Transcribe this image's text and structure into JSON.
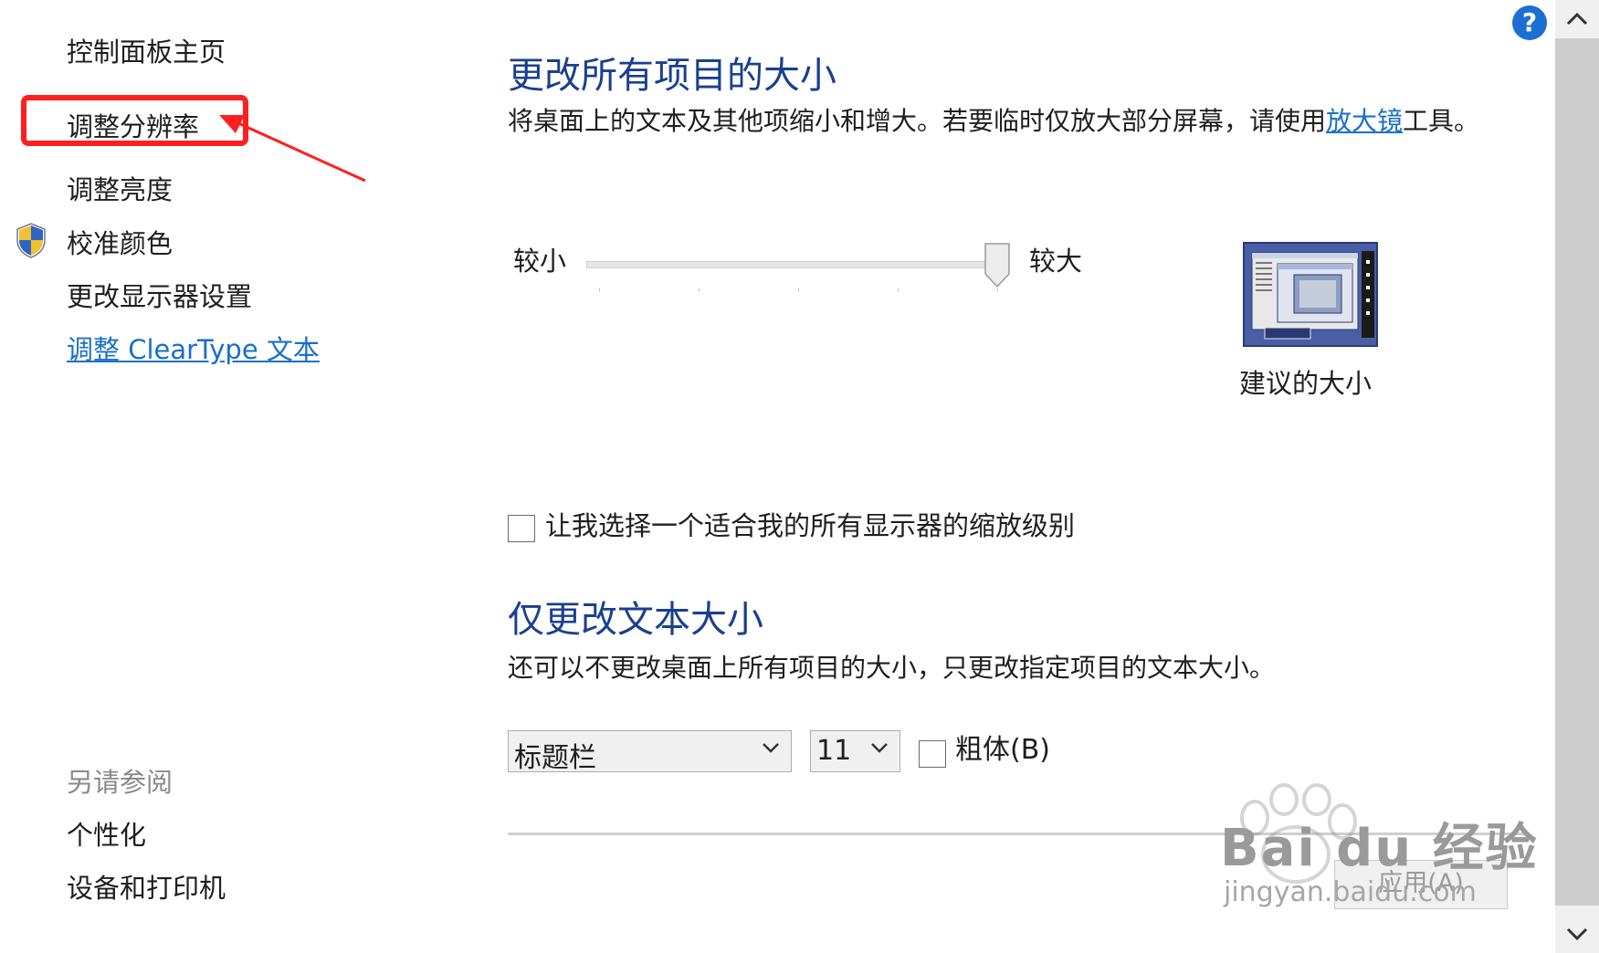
{
  "sidebar": {
    "items": [
      {
        "label": "控制面板主页"
      },
      {
        "label": "调整分辨率"
      },
      {
        "label": "调整亮度"
      },
      {
        "label": "校准颜色"
      },
      {
        "label": "更改显示器设置"
      },
      {
        "label": "调整 ClearType 文本"
      }
    ],
    "see_also": {
      "title": "另请参阅",
      "items": [
        {
          "label": "个性化"
        },
        {
          "label": "设备和打印机"
        }
      ]
    }
  },
  "main": {
    "section1": {
      "title": "更改所有项目的大小",
      "description_before": "将桌面上的文本及其他项缩小和增大。若要临时仅放大部分屏幕，请使用",
      "description_link": "放大镜",
      "description_after": "工具。"
    },
    "slider": {
      "min_label": "较小",
      "max_label": "较大",
      "level": 1.0
    },
    "preview": {
      "caption": "建议的大小"
    },
    "scale_checkbox": {
      "label": "让我选择一个适合我的所有显示器的缩放级别",
      "checked": false
    },
    "section2": {
      "title": "仅更改文本大小",
      "description": "还可以不更改桌面上所有项目的大小，只更改指定项目的文本大小。"
    },
    "item_select": {
      "value": "标题栏"
    },
    "size_select": {
      "value": "11"
    },
    "bold_checkbox": {
      "label": "粗体(B)",
      "checked": false
    },
    "apply_button": {
      "label": "应用(A)"
    }
  },
  "help": {
    "label": "?"
  },
  "watermark": {
    "brand": "Bai du 经验",
    "url": "jingyan.baidu.com"
  },
  "colors": {
    "heading": "#1a3f8f",
    "link": "#1a6fc9",
    "highlight": "#ff1f1f",
    "help": "#1b6fd1"
  }
}
